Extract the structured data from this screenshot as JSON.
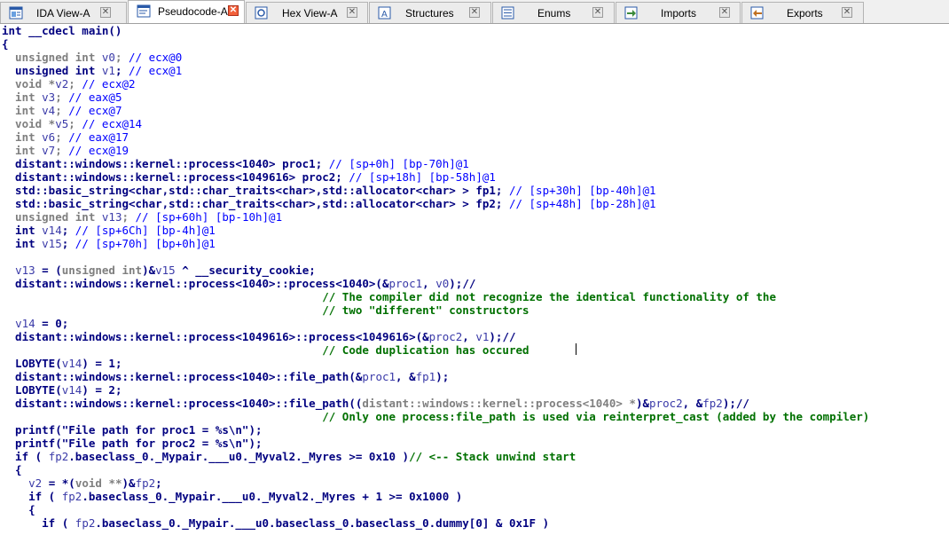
{
  "tabs": [
    {
      "label": "IDA View-A",
      "icon": "ida-view-icon",
      "active": false
    },
    {
      "label": "Pseudocode-A",
      "icon": "pseudocode-icon",
      "active": true
    },
    {
      "label": "Hex View-A",
      "icon": "hex-view-icon",
      "active": false
    },
    {
      "label": "Structures",
      "icon": "structures-icon",
      "active": false
    },
    {
      "label": "Enums",
      "icon": "enums-icon",
      "active": false
    },
    {
      "label": "Imports",
      "icon": "imports-icon",
      "active": false
    },
    {
      "label": "Exports",
      "icon": "exports-icon",
      "active": false
    }
  ],
  "code_lines": [
    [
      [
        "t",
        "int __cdecl main()"
      ]
    ],
    [
      [
        "t",
        "{"
      ]
    ],
    [
      [
        "g",
        "  unsigned int "
      ],
      [
        "v",
        "v0"
      ],
      [
        "g",
        "; "
      ],
      [
        "c",
        "// ecx@0"
      ]
    ],
    [
      [
        "t",
        "  unsigned int "
      ],
      [
        "v",
        "v1"
      ],
      [
        "t",
        "; "
      ],
      [
        "c",
        "// ecx@1"
      ]
    ],
    [
      [
        "g",
        "  void *"
      ],
      [
        "v",
        "v2"
      ],
      [
        "g",
        "; "
      ],
      [
        "c",
        "// ecx@2"
      ]
    ],
    [
      [
        "g",
        "  int "
      ],
      [
        "v",
        "v3"
      ],
      [
        "g",
        "; "
      ],
      [
        "c",
        "// eax@5"
      ]
    ],
    [
      [
        "g",
        "  int "
      ],
      [
        "v",
        "v4"
      ],
      [
        "g",
        "; "
      ],
      [
        "c",
        "// ecx@7"
      ]
    ],
    [
      [
        "g",
        "  void *"
      ],
      [
        "v",
        "v5"
      ],
      [
        "g",
        "; "
      ],
      [
        "c",
        "// ecx@14"
      ]
    ],
    [
      [
        "g",
        "  int "
      ],
      [
        "v",
        "v6"
      ],
      [
        "g",
        "; "
      ],
      [
        "c",
        "// eax@17"
      ]
    ],
    [
      [
        "g",
        "  int "
      ],
      [
        "v",
        "v7"
      ],
      [
        "g",
        "; "
      ],
      [
        "c",
        "// ecx@19"
      ]
    ],
    [
      [
        "t",
        "  distant::windows::kernel::process<1040> proc1; "
      ],
      [
        "c",
        "// [sp+0h] [bp-70h]@1"
      ]
    ],
    [
      [
        "t",
        "  distant::windows::kernel::process<1049616> proc2; "
      ],
      [
        "c",
        "// [sp+18h] [bp-58h]@1"
      ]
    ],
    [
      [
        "t",
        "  std::basic_string<char,std::char_traits<char>,std::allocator<char> > fp1; "
      ],
      [
        "c",
        "// [sp+30h] [bp-40h]@1"
      ]
    ],
    [
      [
        "t",
        "  std::basic_string<char,std::char_traits<char>,std::allocator<char> > fp2; "
      ],
      [
        "c",
        "// [sp+48h] [bp-28h]@1"
      ]
    ],
    [
      [
        "g",
        "  unsigned int "
      ],
      [
        "v",
        "v13"
      ],
      [
        "g",
        "; "
      ],
      [
        "c",
        "// [sp+60h] [bp-10h]@1"
      ]
    ],
    [
      [
        "t",
        "  int "
      ],
      [
        "v",
        "v14"
      ],
      [
        "t",
        "; "
      ],
      [
        "c",
        "// [sp+6Ch] [bp-4h]@1"
      ]
    ],
    [
      [
        "t",
        "  int "
      ],
      [
        "v",
        "v15"
      ],
      [
        "t",
        "; "
      ],
      [
        "c",
        "// [sp+70h] [bp+0h]@1"
      ]
    ],
    [
      [
        "t",
        ""
      ]
    ],
    [
      [
        "t",
        "  "
      ],
      [
        "v",
        "v13"
      ],
      [
        "t",
        " = ("
      ],
      [
        "g",
        "unsigned int"
      ],
      [
        "t",
        ")&"
      ],
      [
        "v",
        "v15"
      ],
      [
        "t",
        " ^ __security_cookie;"
      ]
    ],
    [
      [
        "t",
        "  distant::windows::kernel::process<1040>::process<1040>(&"
      ],
      [
        "v",
        "proc1"
      ],
      [
        "t",
        ", "
      ],
      [
        "v",
        "v0"
      ],
      [
        "t",
        ");//"
      ]
    ],
    [
      [
        "cm",
        "                                                // The compiler did not recognize the identical functionality of the"
      ]
    ],
    [
      [
        "cm",
        "                                                // two \"different\" constructors"
      ]
    ],
    [
      [
        "t",
        "  "
      ],
      [
        "v",
        "v14"
      ],
      [
        "t",
        " = 0;"
      ]
    ],
    [
      [
        "t",
        "  distant::windows::kernel::process<1049616>::process<1049616>(&"
      ],
      [
        "v",
        "proc2"
      ],
      [
        "t",
        ", "
      ],
      [
        "v",
        "v1"
      ],
      [
        "t",
        ");//"
      ]
    ],
    [
      [
        "cm",
        "                                                // Code duplication has occured"
      ]
    ],
    [
      [
        "t",
        "  LOBYTE("
      ],
      [
        "v",
        "v14"
      ],
      [
        "t",
        ") = 1;"
      ]
    ],
    [
      [
        "t",
        "  distant::windows::kernel::process<1040>::file_path(&"
      ],
      [
        "v",
        "proc1"
      ],
      [
        "t",
        ", &"
      ],
      [
        "v",
        "fp1"
      ],
      [
        "t",
        ");"
      ]
    ],
    [
      [
        "t",
        "  LOBYTE("
      ],
      [
        "v",
        "v14"
      ],
      [
        "t",
        ") = 2;"
      ]
    ],
    [
      [
        "t",
        "  distant::windows::kernel::process<1040>::file_path(("
      ],
      [
        "g",
        "distant::windows::kernel::process<1040> *"
      ],
      [
        "t",
        ")&"
      ],
      [
        "v",
        "proc2"
      ],
      [
        "t",
        ", &"
      ],
      [
        "v",
        "fp2"
      ],
      [
        "t",
        ");//"
      ]
    ],
    [
      [
        "cm",
        "                                                // Only one process:file_path is used via reinterpret_cast (added by the compiler)"
      ]
    ],
    [
      [
        "t",
        "  printf(\"File path for proc1 = %s\\n\");"
      ]
    ],
    [
      [
        "t",
        "  printf(\"File path for proc2 = %s\\n\");"
      ]
    ],
    [
      [
        "t",
        "  if ( "
      ],
      [
        "v",
        "fp2"
      ],
      [
        "t",
        ".baseclass_0._Mypair.___u0._Myval2._Myres >= 0x10 )"
      ],
      [
        "cm",
        "// <-- Stack unwind start"
      ]
    ],
    [
      [
        "t",
        "  {"
      ]
    ],
    [
      [
        "t",
        "    "
      ],
      [
        "v",
        "v2"
      ],
      [
        "t",
        " = *("
      ],
      [
        "g",
        "void **"
      ],
      [
        "t",
        ")&"
      ],
      [
        "v",
        "fp2"
      ],
      [
        "t",
        ";"
      ]
    ],
    [
      [
        "t",
        "    if ( "
      ],
      [
        "v",
        "fp2"
      ],
      [
        "t",
        ".baseclass_0._Mypair.___u0._Myval2._Myres + 1 >= 0x1000 )"
      ]
    ],
    [
      [
        "t",
        "    {"
      ]
    ],
    [
      [
        "t",
        "      if ( "
      ],
      [
        "v",
        "fp2"
      ],
      [
        "t",
        ".baseclass_0._Mypair.___u0.baseclass_0.baseclass_0.dummy[0] & 0x1F )"
      ]
    ]
  ]
}
